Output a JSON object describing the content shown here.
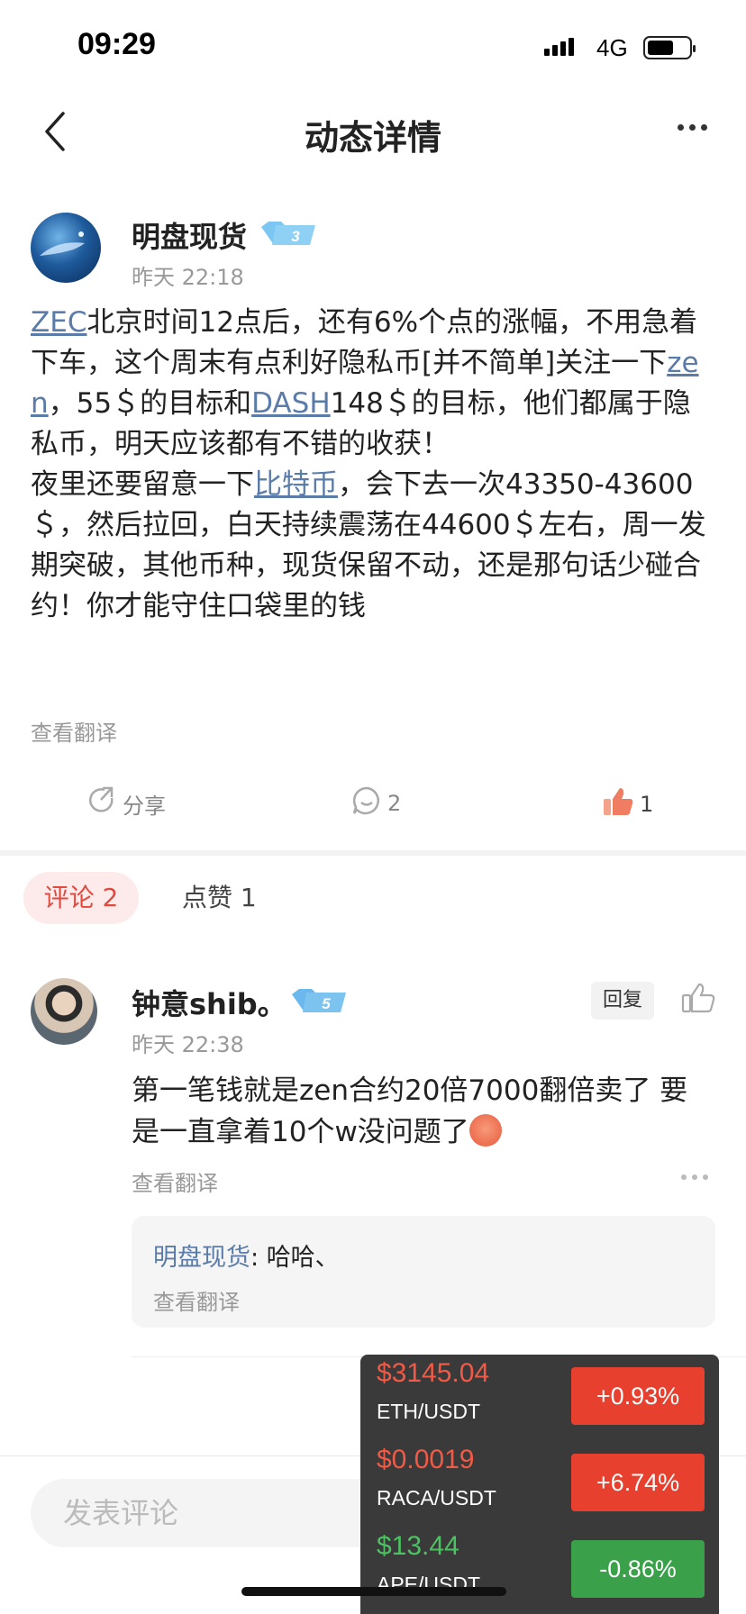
{
  "status_bar": {
    "time": "09:29",
    "network": "4G"
  },
  "nav": {
    "title": "动态详情"
  },
  "post": {
    "author": "明盘现货",
    "level": "3",
    "time": "昨天 22:18",
    "body": [
      {
        "t": "ZEC",
        "link": true
      },
      {
        "t": "北京时间12点后，还有6%个点的涨幅，不用急着下车，这个周末有点利好隐私币[并不简单]关注一下"
      },
      {
        "t": "zen",
        "link": true
      },
      {
        "t": "，55＄的目标和"
      },
      {
        "t": "DASH",
        "link": true
      },
      {
        "t": "148＄的目标，他们都属于隐私币，明天应该都有不错的收获！\n夜里还要留意一下"
      },
      {
        "t": "比特币",
        "link": true
      },
      {
        "t": "，会下去一次43350-43600＄，然后拉回，白天持续震荡在44600＄左右，周一发期突破，其他币种，现货保留不动，还是那句话少碰合约！你才能守住口袋里的钱"
      }
    ],
    "translate": "查看翻译",
    "share_label": "分享",
    "comment_count": "2",
    "like_count": "1"
  },
  "tabs": [
    {
      "label": "评论 2",
      "active": true
    },
    {
      "label": "点赞 1",
      "active": false
    }
  ],
  "comment": {
    "author": "钟意shib。",
    "level": "5",
    "time": "昨天 22:38",
    "reply_label": "回复",
    "text": "第一笔钱就是zen合约20倍7000翻倍卖了  要是一直拿着10个w没问题了",
    "translate": "查看翻译",
    "reply": {
      "author": "明盘现货",
      "sep": ": ",
      "text": "哈哈、",
      "translate": "查看翻译"
    }
  },
  "input": {
    "placeholder": "发表评论"
  },
  "ticker": [
    {
      "price": "$3145.04",
      "pair": "ETH/USDT",
      "change": "+0.93%",
      "up": true
    },
    {
      "price": "$0.0019",
      "pair": "RACA/USDT",
      "change": "+6.74%",
      "up": true
    },
    {
      "price": "$13.44",
      "pair": "APE/USDT",
      "change": "-0.86%",
      "up": false
    }
  ],
  "colors": {
    "up": "#e8402f",
    "down": "#3aa14a",
    "up_price": "#f05a46",
    "down_price": "#4cc262",
    "link": "#5b7ca8",
    "accent": "#e04a3f"
  }
}
